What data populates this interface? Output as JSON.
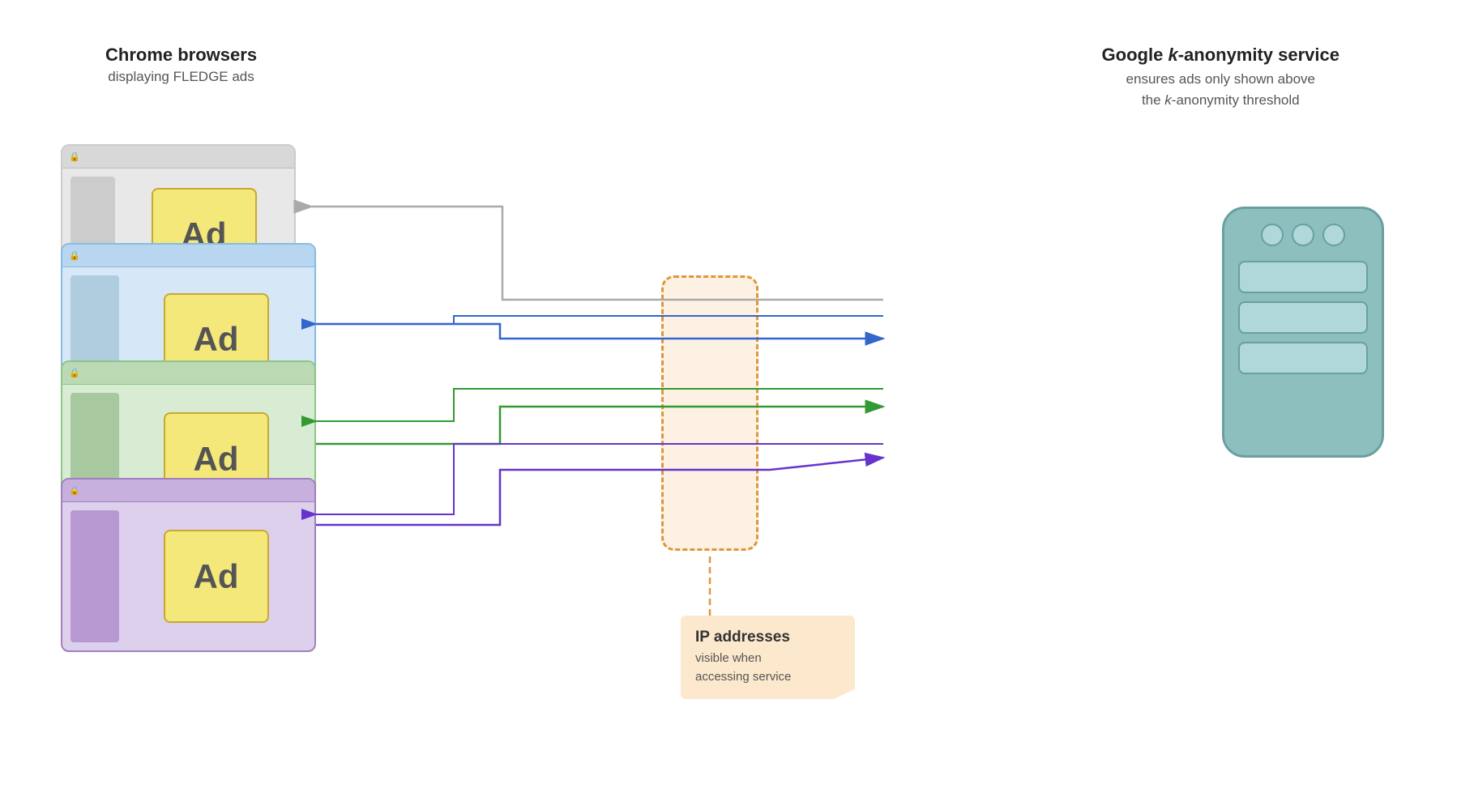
{
  "header_left": {
    "title": "Chrome browsers",
    "subtitle": "displaying FLEDGE ads"
  },
  "header_right": {
    "title_prefix": "Google ",
    "title_italic": "k",
    "title_suffix": "-anonymity service",
    "subtitle_line1": "ensures ads only shown above",
    "subtitle_line2": "the ",
    "subtitle_italic": "k",
    "subtitle_suffix": "-anonymity threshold"
  },
  "browsers": [
    {
      "color": "gray",
      "ad_text": "Ad"
    },
    {
      "color": "blue",
      "ad_text": "Ad"
    },
    {
      "color": "green",
      "ad_text": "Ad"
    },
    {
      "color": "purple",
      "ad_text": "Ad"
    }
  ],
  "ip_box": {
    "title": "IP addresses",
    "subtitle": "visible when\naccessing service"
  },
  "arrows": {
    "colors": {
      "gray": "#aaaaaa",
      "blue": "#3366cc",
      "green": "#339933",
      "purple": "#6633cc"
    }
  }
}
